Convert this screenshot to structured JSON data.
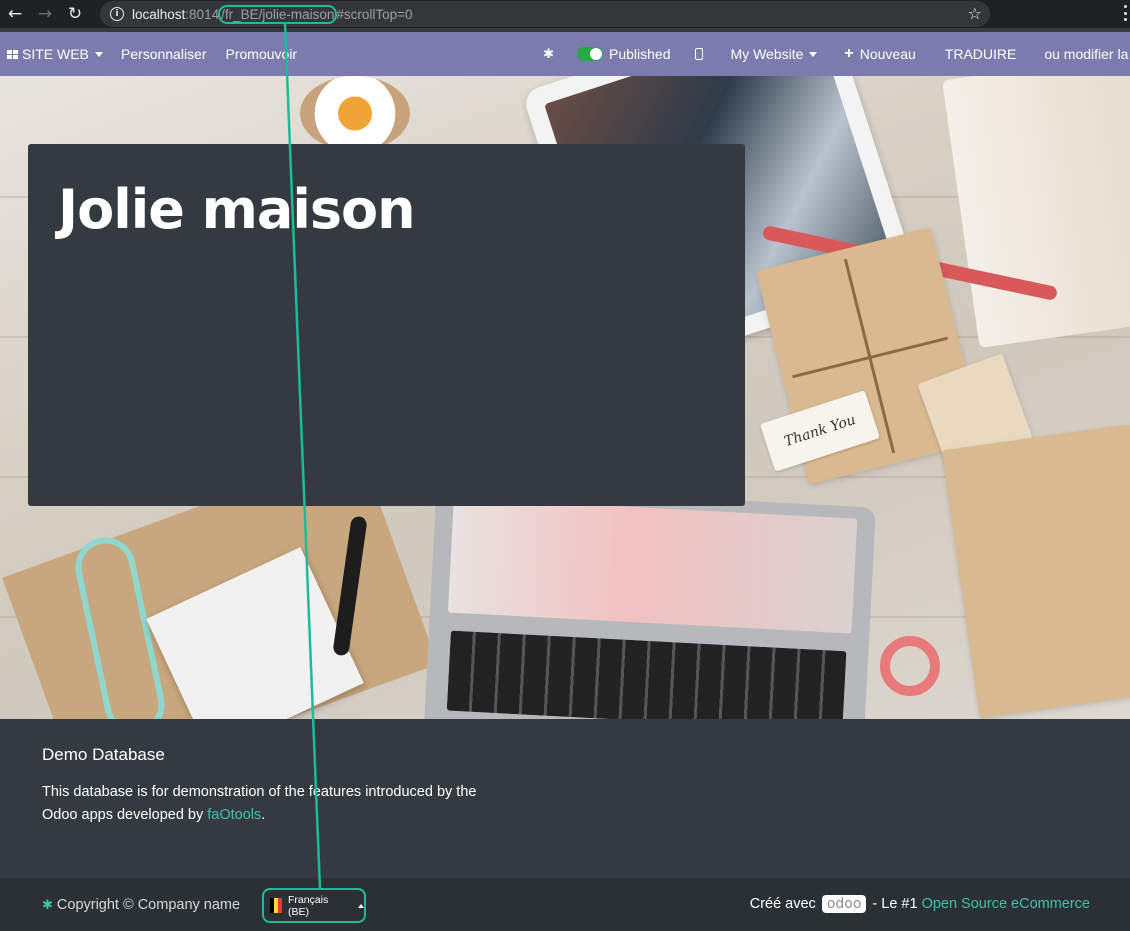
{
  "browser": {
    "url_host": "localhost",
    "url_port": ":8014",
    "url_path": "/fr_BE/jolie-maison",
    "url_hash": "#scrollTop=0"
  },
  "navbar": {
    "site_menu": "SITE WEB",
    "customize": "Personnaliser",
    "promote": "Promouvoir",
    "published_label": "Published",
    "website_menu": "My Website",
    "new_label": "Nouveau",
    "translate": "TRADUIRE",
    "edit_source": "ou modifier la source"
  },
  "hero": {
    "title": "Jolie maison",
    "tag_text": "Thank You"
  },
  "footer": {
    "title": "Demo Database",
    "text_before": "This database is for demonstration of the features introduced by the Odoo apps developed by ",
    "link": "faOtools",
    "text_after": "."
  },
  "copyright": {
    "text": "Copyright © Company name",
    "language": "Français (BE)",
    "created_with": "Créé avec",
    "odoo_logo": "odoo",
    "tagline": "- Le #1",
    "ecommerce_link": "Open Source eCommerce"
  },
  "colors": {
    "navbar": "#7c7bad",
    "footer": "#343a40",
    "accent": "#3ec1ad",
    "highlight": "#1abc9c",
    "published_toggle": "#28a745"
  },
  "icons": {
    "back": "arrow-left-icon",
    "forward": "arrow-right-icon",
    "reload": "reload-icon",
    "info": "info-icon",
    "bookmark": "star-icon",
    "menu": "kebab-icon",
    "apps": "grid-icon",
    "debug": "bug-icon",
    "mobile": "mobile-icon",
    "new": "plus-icon",
    "flag": "belgian-flag-icon"
  }
}
